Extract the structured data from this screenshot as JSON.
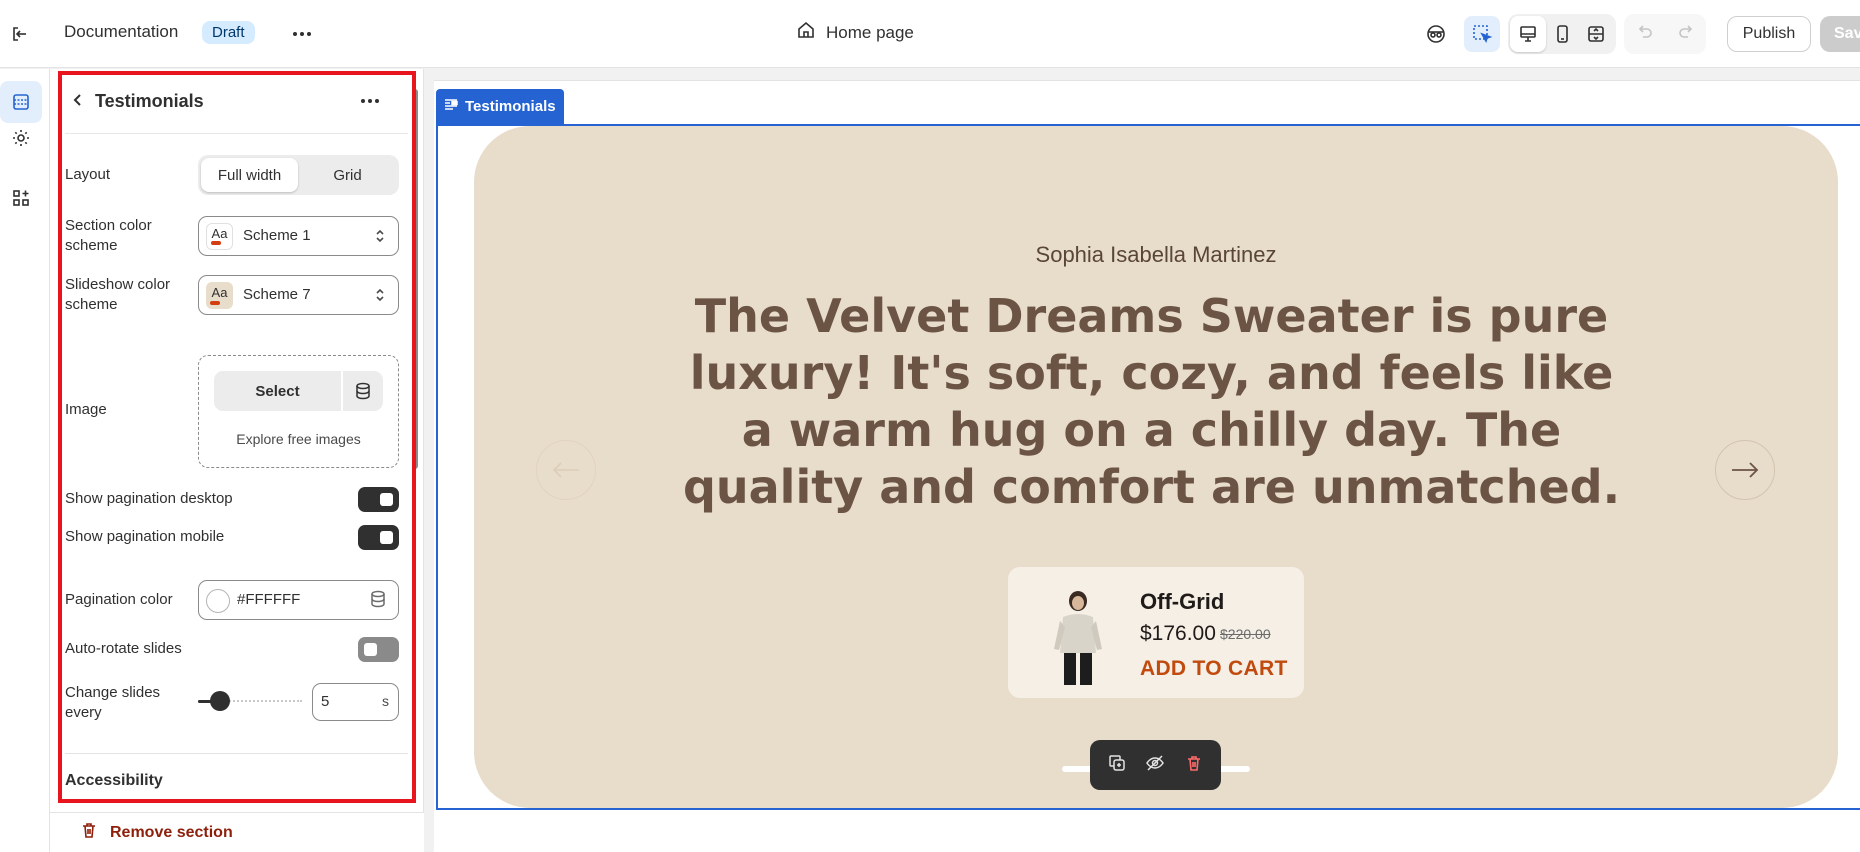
{
  "topbar": {
    "store_name": "Documentation",
    "status_badge": "Draft",
    "page_name": "Home page",
    "publish_label": "Publish",
    "save_label": "Save"
  },
  "panel": {
    "title": "Testimonials",
    "layout_label": "Layout",
    "layout_options": [
      "Full width",
      "Grid"
    ],
    "layout_selected": "Full width",
    "section_scheme_label": "Section color scheme",
    "section_scheme_value": "Scheme 1",
    "slideshow_scheme_label": "Slideshow color scheme",
    "slideshow_scheme_value": "Scheme 7",
    "swatch_text": "Aa",
    "image_label": "Image",
    "select_label": "Select",
    "explore_label": "Explore free images",
    "pagination_desktop_label": "Show pagination desktop",
    "pagination_desktop_on": true,
    "pagination_mobile_label": "Show pagination mobile",
    "pagination_mobile_on": true,
    "pagination_color_label": "Pagination color",
    "pagination_color_value": "#FFFFFF",
    "autorotate_label": "Auto-rotate slides",
    "autorotate_on": false,
    "change_slides_label": "Change slides every",
    "change_slides_value": "5",
    "change_slides_unit": "s",
    "accessibility_label": "Accessibility",
    "remove_label": "Remove section"
  },
  "preview": {
    "section_tag": "Testimonials",
    "author": "Sophia Isabella Martinez",
    "quote": "The Velvet Dreams Sweater is pure luxury! It's soft, cozy, and feels like a warm hug on a chilly day. The quality and comfort are unmatched.",
    "product_name": "Off-Grid",
    "price": "$176.00",
    "compare_price": "$220.00",
    "add_to_cart": "ADD TO CART"
  },
  "colors": {
    "accent": "#2463d1",
    "card_bg": "#e8dccb",
    "quote_text": "#6b5444",
    "add_to_cart": "#c14a0f",
    "highlight": "#e8141e"
  }
}
